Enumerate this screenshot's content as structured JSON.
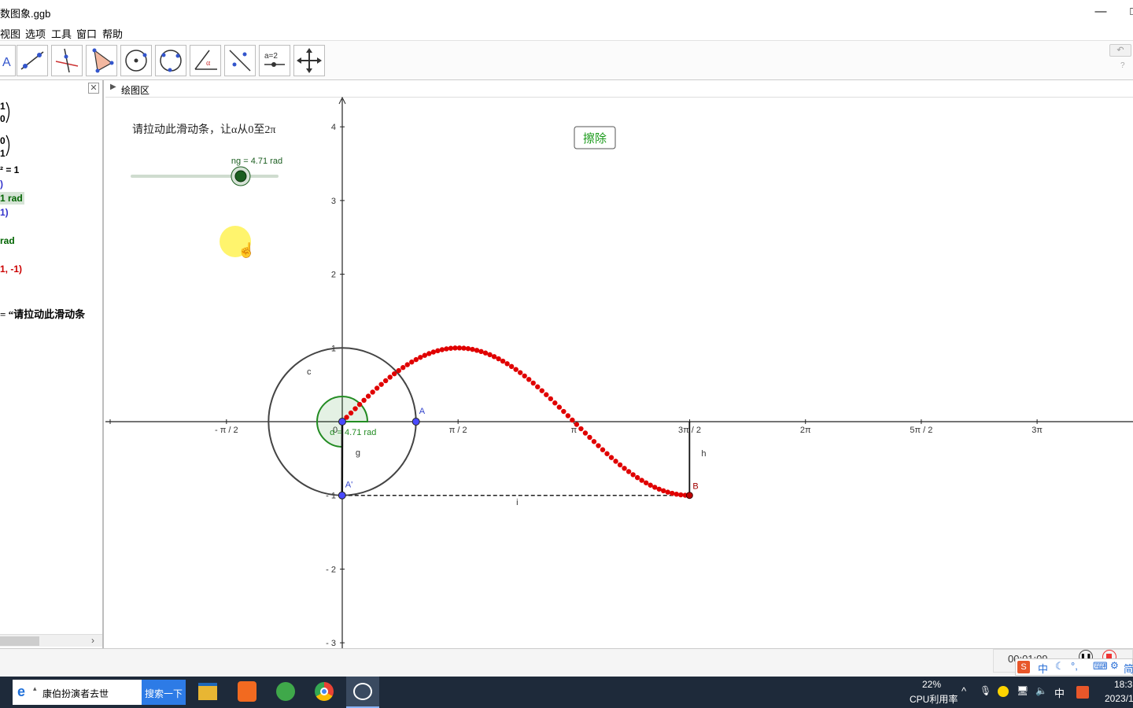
{
  "window": {
    "title": "数图象.ggb",
    "minimize": "—",
    "restore": "□"
  },
  "menu": [
    "视图",
    "选项",
    "工具",
    "窗口",
    "帮助"
  ],
  "algebra": {
    "lines": [
      {
        "text": "1",
        "color": "#000000"
      },
      {
        "text": "0",
        "color": "#000000"
      },
      {
        "text": "0",
        "color": "#000000"
      },
      {
        "text": "1",
        "color": "#000000"
      },
      {
        "text": "² = 1",
        "color": "#000000"
      },
      {
        "text": ")",
        "color": "#3333cc"
      },
      {
        "text": "1 rad",
        "color": "#006400"
      },
      {
        "text": "1)",
        "color": "#3333cc"
      },
      {
        "text": "rad",
        "color": "#006400"
      },
      {
        "text": "1, -1)",
        "color": "#cc0000"
      },
      {
        "text": "= “请拉动此滑动条",
        "color": "#000000"
      }
    ]
  },
  "graphics": {
    "header": "绘图区",
    "instruction": "请拉动此滑动条，让α从0至2π",
    "slider_label": "ng = 4.71 rad",
    "slider_value": 4.71,
    "slider_max": 6.2832,
    "erase_button": "擦除",
    "angle_label": "α = 4.71 rad",
    "x_ticks": [
      {
        "label": "- π / 2",
        "value": -1.5708
      },
      {
        "label": "π / 2",
        "value": 1.5708
      },
      {
        "label": "π",
        "value": 3.1416
      },
      {
        "label": "3π / 2",
        "value": 4.7124
      },
      {
        "label": "2π",
        "value": 6.2832
      },
      {
        "label": "5π / 2",
        "value": 7.854
      },
      {
        "label": "3π",
        "value": 9.4248
      }
    ],
    "y_ticks": [
      {
        "label": "4",
        "value": 4
      },
      {
        "label": "3",
        "value": 3
      },
      {
        "label": "2",
        "value": 2
      },
      {
        "label": "1",
        "value": 1
      },
      {
        "label": "- 1",
        "value": -1
      },
      {
        "label": "- 2",
        "value": -2
      },
      {
        "label": "- 3",
        "value": -3
      }
    ],
    "origin_label": "0",
    "labels": {
      "circle": "c",
      "A": "A",
      "Aprime": "A'",
      "B": "B",
      "g": "g",
      "h": "h",
      "i": "i"
    },
    "curve_end": 4.71,
    "colors": {
      "curve": "#e00000",
      "point": "#4a4aff",
      "angle": "#228b22",
      "slider": "#1b5e20"
    }
  },
  "recorder": {
    "time": "00:01:09"
  },
  "taskbar": {
    "search_text": "康伯扮演者去世",
    "search_button": "搜索一下",
    "cpu_percent": "22%",
    "cpu_label": "CPU利用率",
    "ime": "中",
    "clock_time": "18:3",
    "clock_date": "2023/1",
    "ime_bar": [
      "中",
      "简"
    ]
  }
}
